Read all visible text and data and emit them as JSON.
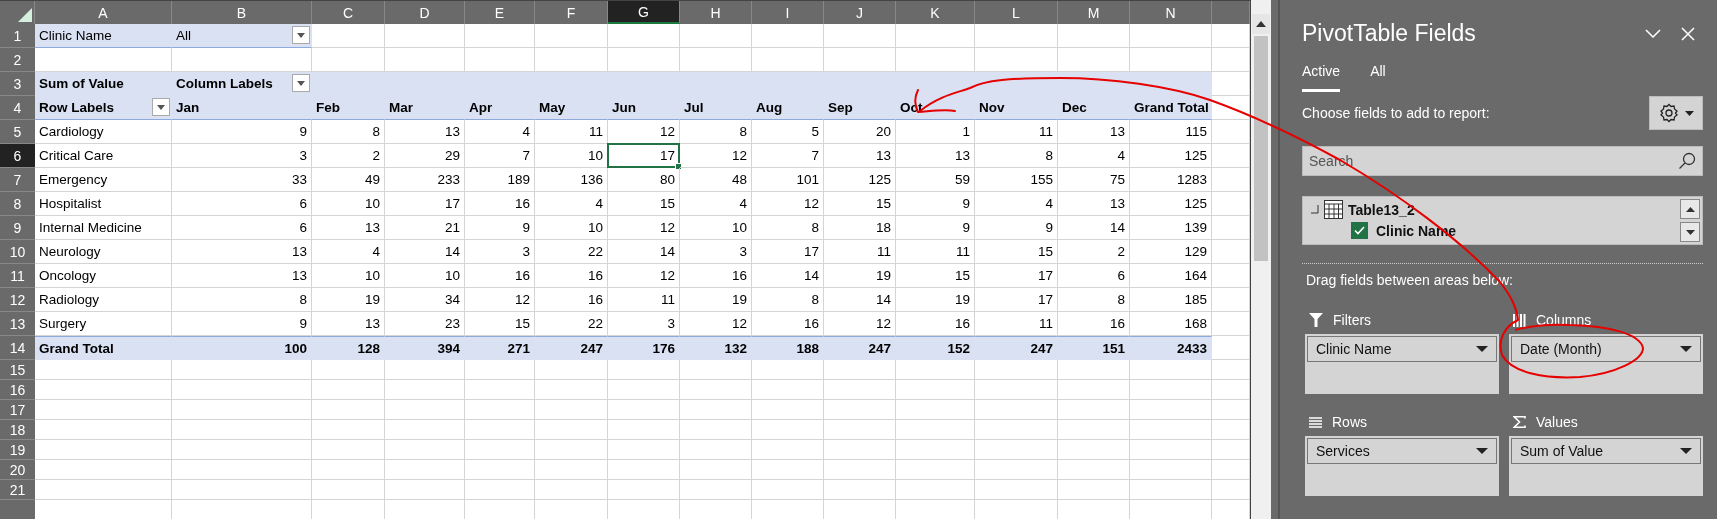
{
  "sheet": {
    "column_headers": [
      {
        "label": "A",
        "selected": false
      },
      {
        "label": "B",
        "selected": false
      },
      {
        "label": "C",
        "selected": false
      },
      {
        "label": "D",
        "selected": false
      },
      {
        "label": "E",
        "selected": false
      },
      {
        "label": "F",
        "selected": false
      },
      {
        "label": "G",
        "selected": true
      },
      {
        "label": "H",
        "selected": false
      },
      {
        "label": "I",
        "selected": false
      },
      {
        "label": "J",
        "selected": false
      },
      {
        "label": "K",
        "selected": false
      },
      {
        "label": "L",
        "selected": false
      },
      {
        "label": "M",
        "selected": false
      },
      {
        "label": "N",
        "selected": false
      }
    ],
    "row_numbers": [
      {
        "label": "1",
        "selected": false
      },
      {
        "label": "2",
        "selected": false
      },
      {
        "label": "3",
        "selected": false
      },
      {
        "label": "4",
        "selected": false
      },
      {
        "label": "5",
        "selected": false
      },
      {
        "label": "6",
        "selected": true
      },
      {
        "label": "7",
        "selected": false
      },
      {
        "label": "8",
        "selected": false
      },
      {
        "label": "9",
        "selected": false
      },
      {
        "label": "10",
        "selected": false
      },
      {
        "label": "11",
        "selected": false
      },
      {
        "label": "12",
        "selected": false
      },
      {
        "label": "13",
        "selected": false
      },
      {
        "label": "14",
        "selected": false
      },
      {
        "label": "15",
        "selected": false
      },
      {
        "label": "16",
        "selected": false
      },
      {
        "label": "17",
        "selected": false
      },
      {
        "label": "18",
        "selected": false
      },
      {
        "label": "19",
        "selected": false
      },
      {
        "label": "20",
        "selected": false
      },
      {
        "label": "21",
        "selected": false
      }
    ]
  },
  "pivot": {
    "filter": {
      "label": "Clinic Name",
      "value": "All"
    },
    "values_label": "Sum of Value",
    "column_labels": "Column Labels",
    "row_labels": "Row Labels",
    "columns": [
      "Jan",
      "Feb",
      "Mar",
      "Apr",
      "May",
      "Jun",
      "Jul",
      "Aug",
      "Sep",
      "Oct",
      "Nov",
      "Dec",
      "Grand Total"
    ],
    "rows": [
      {
        "label": "Cardiology",
        "values": [
          "9",
          "8",
          "13",
          "4",
          "11",
          "12",
          "8",
          "5",
          "20",
          "1",
          "11",
          "13",
          "115"
        ]
      },
      {
        "label": "Critical Care",
        "values": [
          "3",
          "2",
          "29",
          "7",
          "10",
          "17",
          "12",
          "7",
          "13",
          "13",
          "8",
          "4",
          "125"
        ]
      },
      {
        "label": "Emergency",
        "values": [
          "33",
          "49",
          "233",
          "189",
          "136",
          "80",
          "48",
          "101",
          "125",
          "59",
          "155",
          "75",
          "1283"
        ]
      },
      {
        "label": "Hospitalist",
        "values": [
          "6",
          "10",
          "17",
          "16",
          "4",
          "15",
          "4",
          "12",
          "15",
          "9",
          "4",
          "13",
          "125"
        ]
      },
      {
        "label": "Internal Medicine",
        "values": [
          "6",
          "13",
          "21",
          "9",
          "10",
          "12",
          "10",
          "8",
          "18",
          "9",
          "9",
          "14",
          "139"
        ]
      },
      {
        "label": "Neurology",
        "values": [
          "13",
          "4",
          "14",
          "3",
          "22",
          "14",
          "3",
          "17",
          "11",
          "11",
          "15",
          "2",
          "129"
        ]
      },
      {
        "label": "Oncology",
        "values": [
          "13",
          "10",
          "10",
          "16",
          "16",
          "12",
          "16",
          "14",
          "19",
          "15",
          "17",
          "6",
          "164"
        ]
      },
      {
        "label": "Radiology",
        "values": [
          "8",
          "19",
          "34",
          "12",
          "16",
          "11",
          "19",
          "8",
          "14",
          "19",
          "17",
          "8",
          "185"
        ]
      },
      {
        "label": "Surgery",
        "values": [
          "9",
          "13",
          "23",
          "15",
          "22",
          "3",
          "12",
          "16",
          "12",
          "16",
          "11",
          "16",
          "168"
        ]
      }
    ],
    "grand_total": {
      "label": "Grand Total",
      "values": [
        "100",
        "128",
        "394",
        "271",
        "247",
        "176",
        "132",
        "188",
        "247",
        "152",
        "247",
        "151",
        "2433"
      ]
    }
  },
  "panel": {
    "title": "PivotTable Fields",
    "tabs": [
      {
        "label": "Active",
        "selected": true
      },
      {
        "label": "All",
        "selected": false
      }
    ],
    "choose_label": "Choose fields to add to report:",
    "search": {
      "placeholder": "Search"
    },
    "field_list": {
      "table": "Table13_2",
      "fields": [
        {
          "label": "Clinic Name",
          "checked": true
        }
      ]
    },
    "drag_label": "Drag fields between areas below:",
    "areas": [
      {
        "kind": "filters",
        "label": "Filters",
        "fields": [
          "Clinic Name"
        ]
      },
      {
        "kind": "columns",
        "label": "Columns",
        "fields": [
          "Date (Month)"
        ]
      },
      {
        "kind": "rows",
        "label": "Rows",
        "fields": [
          "Services"
        ]
      },
      {
        "kind": "values",
        "label": "Values",
        "fields": [
          "Sum of Value"
        ]
      }
    ]
  }
}
